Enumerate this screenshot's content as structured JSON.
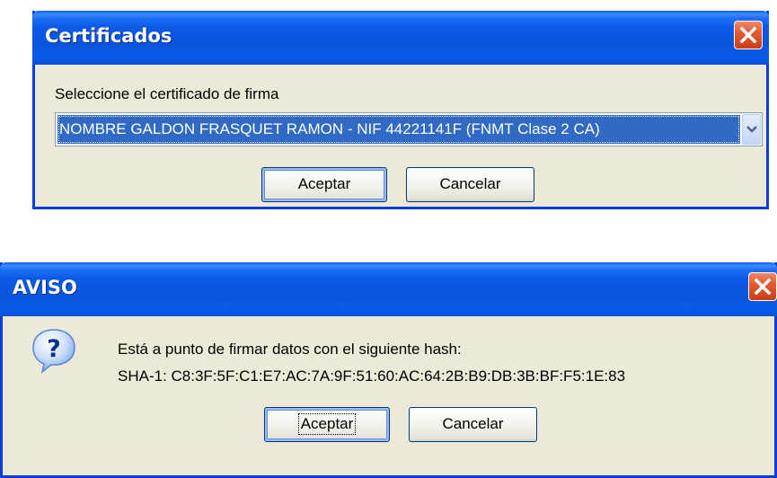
{
  "dialog_certificados": {
    "title": "Certificados",
    "label": "Seleccione el certificado de firma",
    "selected_certificate": "NOMBRE GALDON FRASQUET RAMON - NIF 44221141F (FNMT Clase 2 CA)",
    "accept_label": "Aceptar",
    "cancel_label": "Cancelar"
  },
  "dialog_aviso": {
    "title": "AVISO",
    "message_line1": "Está a punto de firmar datos con el siguiente hash:",
    "message_line2": "SHA-1: C8:3F:5F:C1:E7:AC:7A:9F:51:60:AC:64:2B:B9:DB:3B:BF:F5:1E:83",
    "accept_label": "Aceptar",
    "cancel_label": "Cancelar",
    "icon": "question-icon"
  },
  "colors": {
    "titlebar": "#0a55dc",
    "window_bg": "#ece9d8",
    "close_button": "#e35a31",
    "selection": "#316ac5"
  }
}
